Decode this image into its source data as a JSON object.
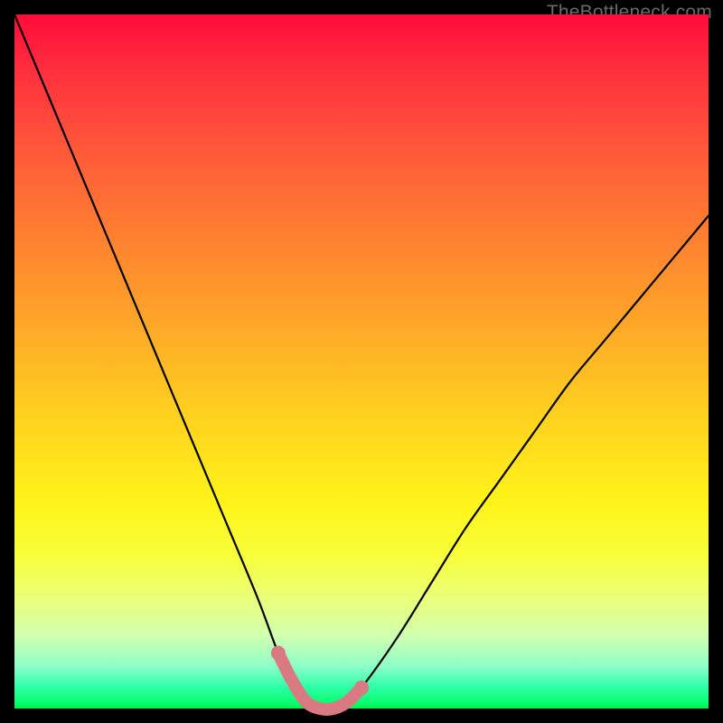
{
  "watermark": "TheBottleneck.com",
  "colors": {
    "frame": "#000000",
    "curve": "#000000",
    "highlight": "#d97a82",
    "highlight_dot": "#d97a82"
  },
  "chart_data": {
    "type": "line",
    "title": "",
    "xlabel": "",
    "ylabel": "",
    "xlim": [
      0,
      100
    ],
    "ylim": [
      0,
      100
    ],
    "grid": false,
    "legend": false,
    "series": [
      {
        "name": "bottleneck-curve",
        "x": [
          0,
          5,
          10,
          15,
          20,
          25,
          30,
          35,
          38,
          40,
          42,
          44,
          46,
          48,
          50,
          55,
          60,
          65,
          70,
          75,
          80,
          85,
          90,
          95,
          100
        ],
        "y": [
          100,
          88,
          76,
          64,
          52,
          40,
          28,
          16,
          8,
          4,
          1,
          0,
          0,
          1,
          3,
          10,
          18,
          26,
          33,
          40,
          47,
          53,
          59,
          65,
          71
        ]
      }
    ],
    "annotations": [
      {
        "name": "optimal-zone",
        "type": "highlight-segment",
        "x_range": [
          38,
          50
        ],
        "note": "thick pink band at curve minimum"
      }
    ]
  }
}
